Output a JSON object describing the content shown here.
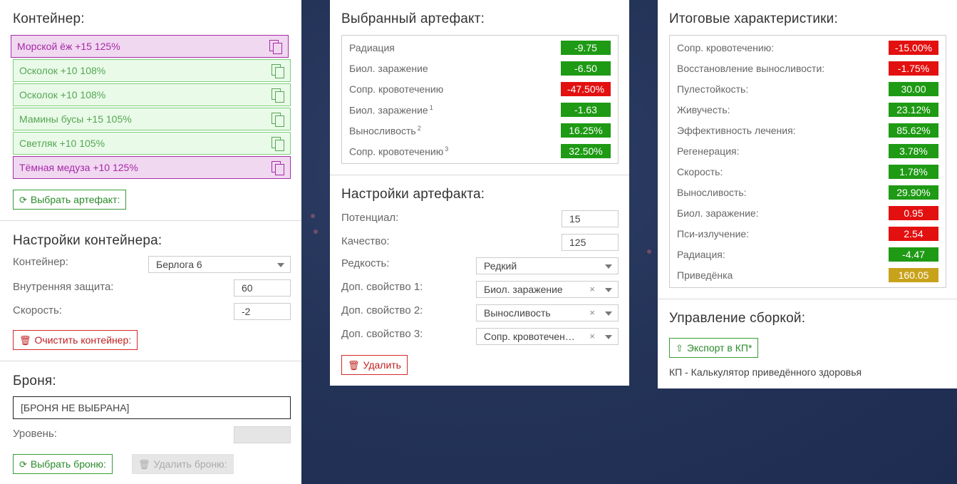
{
  "colors": {
    "green": "#1e9a14",
    "red": "#e31010",
    "gold": "#c9a21c",
    "purple": "#a82ba8",
    "light_green": "#e9fbe8"
  },
  "container": {
    "title": "Контейнер:",
    "artifacts": [
      {
        "label": "Морской ёж +15 125%",
        "variant": "purple",
        "icon": "copy-icon"
      },
      {
        "label": "Осколок +10 108%",
        "variant": "green",
        "icon": "copy-icon"
      },
      {
        "label": "Осколок +10 108%",
        "variant": "green",
        "icon": "copy-icon"
      },
      {
        "label": "Мамины бусы +15 105%",
        "variant": "green",
        "icon": "copy-icon"
      },
      {
        "label": "Светляк +10 105%",
        "variant": "green",
        "icon": "copy-icon"
      },
      {
        "label": "Тёмная медуза +10 125%",
        "variant": "purple",
        "icon": "copy-icon"
      }
    ],
    "select_button": "Выбрать артефакт:"
  },
  "container_settings": {
    "title": "Настройки контейнера:",
    "container_label": "Контейнер:",
    "container_value": "Берлога 6",
    "protection_label": "Внутренняя защита:",
    "protection_value": "60",
    "speed_label": "Скорость:",
    "speed_value": "-2",
    "clear_button": "Очистить контейнер:"
  },
  "armor": {
    "title": "Броня:",
    "value": "[БРОНЯ НЕ ВЫБРАНА]",
    "level_label": "Уровень:",
    "select_button": "Выбрать броню:",
    "delete_button": "Удалить броню:"
  },
  "selected_artifact": {
    "title": "Выбранный артефакт:",
    "stats": [
      {
        "name": "Радиация",
        "sup": "",
        "value": "-9.75",
        "color": "green"
      },
      {
        "name": "Биол. заражение",
        "sup": "",
        "value": "-6.50",
        "color": "green"
      },
      {
        "name": "Сопр. кровотечению",
        "sup": "",
        "value": "-47.50%",
        "color": "red"
      },
      {
        "name": "Биол. заражение",
        "sup": "1",
        "value": "-1.63",
        "color": "green"
      },
      {
        "name": "Выносливость",
        "sup": "2",
        "value": "16.25%",
        "color": "green"
      },
      {
        "name": "Сопр. кровотечению",
        "sup": "3",
        "value": "32.50%",
        "color": "green"
      }
    ]
  },
  "artifact_settings": {
    "title": "Настройки артефакта:",
    "potential_label": "Потенциал:",
    "potential_value": "15",
    "quality_label": "Качество:",
    "quality_value": "125",
    "rarity_label": "Редкость:",
    "rarity_value": "Редкий",
    "extra1_label": "Доп. свойство 1:",
    "extra1_value": "Биол. заражение",
    "extra2_label": "Доп. свойство 2:",
    "extra2_value": "Выносливость",
    "extra3_label": "Доп. свойство 3:",
    "extra3_value": "Сопр. кровотечен…",
    "clear_glyph": "×",
    "delete_button": "Удалить"
  },
  "totals": {
    "title": "Итоговые характеристики:",
    "stats": [
      {
        "name": "Сопр. кровотечению:",
        "value": "-15.00%",
        "color": "red"
      },
      {
        "name": "Восстановление выносливости:",
        "value": "-1.75%",
        "color": "red"
      },
      {
        "name": "Пулестойкость:",
        "value": "30.00",
        "color": "green"
      },
      {
        "name": "Живучесть:",
        "value": "23.12%",
        "color": "green"
      },
      {
        "name": "Эффективность лечения:",
        "value": "85.62%",
        "color": "green"
      },
      {
        "name": "Регенерация:",
        "value": "3.78%",
        "color": "green"
      },
      {
        "name": "Скорость:",
        "value": "1.78%",
        "color": "green"
      },
      {
        "name": "Выносливость:",
        "value": "29.90%",
        "color": "green"
      },
      {
        "name": "Биол. заражение:",
        "value": "0.95",
        "color": "red"
      },
      {
        "name": "Пси-излучение:",
        "value": "2.54",
        "color": "red"
      },
      {
        "name": "Радиация:",
        "value": "-4.47",
        "color": "green"
      },
      {
        "name": "Приведёнка",
        "value": "160.05",
        "color": "gold"
      }
    ]
  },
  "build": {
    "title": "Управление сборкой:",
    "export_button": "Экспорт в КП*",
    "footnote": "КП - Калькулятор приведённого здоровья"
  }
}
